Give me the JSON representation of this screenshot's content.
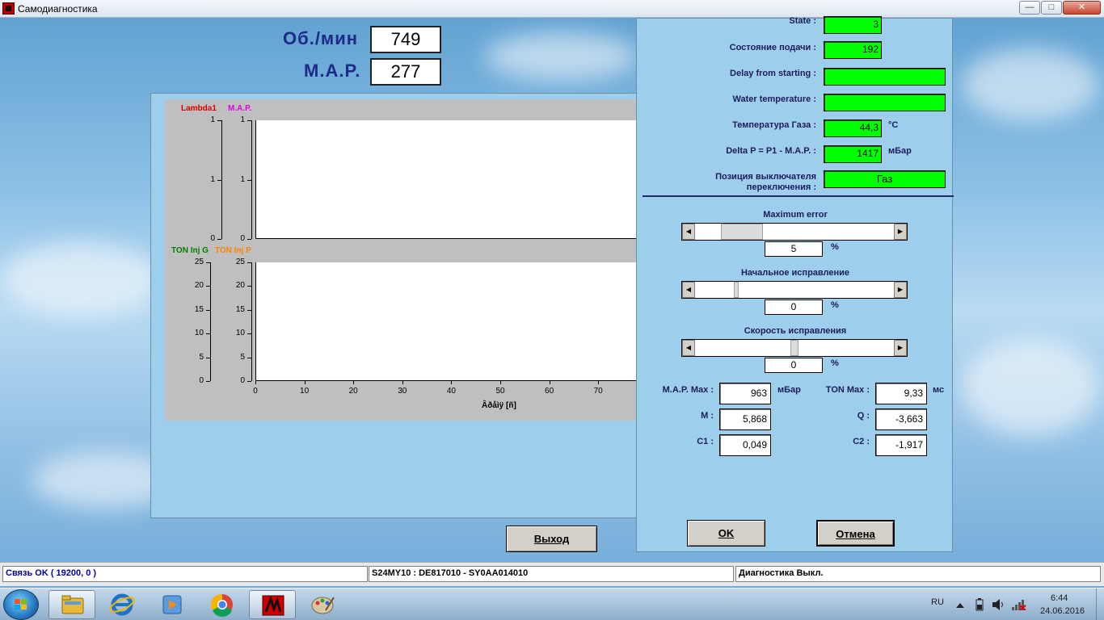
{
  "window": {
    "title": "Самодиагностика",
    "min": "—",
    "max": "□",
    "close": "✕"
  },
  "top": {
    "rpm_label": "Об./мин",
    "rpm_value": "749",
    "map_label": "M.A.P.",
    "map_value": "277"
  },
  "graph": {
    "top_legend": [
      {
        "text": "Lambda1",
        "color": "#e00000"
      },
      {
        "text": "M.A.P.",
        "color": "#e000e0"
      }
    ],
    "bottom_legend": [
      {
        "text": "TON Inj G",
        "color": "#008000"
      },
      {
        "text": "TON Inj P",
        "color": "#ff8000"
      }
    ],
    "top_ticks_a": [
      "1",
      "1",
      "0"
    ],
    "top_ticks_b": [
      "1",
      "1",
      "0"
    ],
    "bottom_ticks_a": [
      "25",
      "20",
      "15",
      "10",
      "5",
      "0"
    ],
    "bottom_ticks_b": [
      "25",
      "20",
      "15",
      "10",
      "5",
      "0"
    ],
    "x_ticks": [
      "0",
      "10",
      "20",
      "30",
      "40",
      "50",
      "60",
      "70"
    ],
    "x_title": "Âðåìÿ [ñ]"
  },
  "exit_label": "Выход",
  "settings": {
    "state_label": "State :",
    "state_value": "3",
    "feed_label": "Состояние подачи :",
    "feed_value": "192",
    "delay_label": "Delay from starting :",
    "delay_value": "",
    "water_label": "Water temperature :",
    "water_value": "",
    "gas_temp_label": "Температура Газа :",
    "gas_temp_value": "44,3",
    "gas_temp_unit": "°C",
    "delta_label": "Delta P = P1 - M.A.P. :",
    "delta_value": "1417",
    "delta_unit": "мБар",
    "switch_label_1": "Позиция выключателя",
    "switch_label_2": "переключения :",
    "switch_value": "Газ"
  },
  "sliders": [
    {
      "title": "Maximum error",
      "value": "5",
      "unit": "%",
      "level": 0.18
    },
    {
      "title": "Начальное исправление",
      "value": "0",
      "unit": "%",
      "level": 0.2
    },
    {
      "title": "Скорость исправления",
      "value": "0",
      "unit": "%",
      "level": 0.5
    }
  ],
  "params": {
    "map_max_label": "M.A.P. Max :",
    "map_max_value": "963",
    "map_max_unit": "мБар",
    "ton_max_label": "TON Max :",
    "ton_max_value": "9,33",
    "ton_max_unit": "мс",
    "m_label": "M :",
    "m_value": "5,868",
    "q_label": "Q :",
    "q_value": "-3,663",
    "c1_label": "C1 :",
    "c1_value": "0,049",
    "c2_label": "C2 :",
    "c2_value": "-1,917"
  },
  "buttons": {
    "ok": "OK",
    "cancel": "Отмена"
  },
  "status": {
    "connection": "Связь OK ( 19200,  0 )",
    "device": "S24MY10 : DE817010 - SY0AA014010",
    "diag": "Диагностика Выкл."
  },
  "taskbar": {
    "apps": [
      "explorer-icon",
      "ie-icon",
      "media-player-icon",
      "chrome-icon",
      "diagnostic-app-icon",
      "paint-icon"
    ],
    "lang": "RU",
    "time": "6:44",
    "date": "24.06.2016"
  }
}
